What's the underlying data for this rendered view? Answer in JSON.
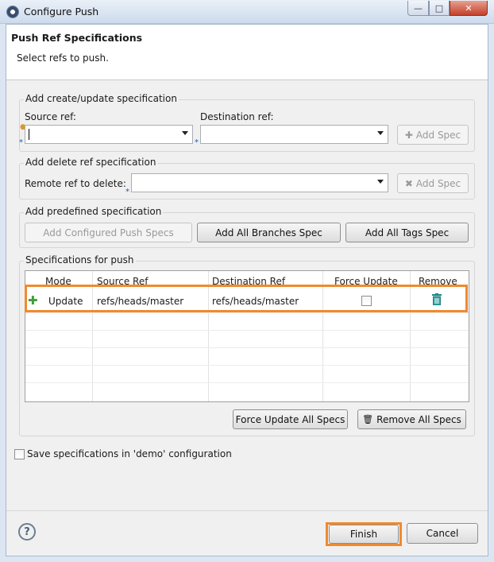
{
  "window": {
    "title": "Configure Push"
  },
  "header": {
    "title": "Push Ref Specifications",
    "subtitle": "Select refs to push."
  },
  "create_group": {
    "label": "Add create/update specification",
    "source_label": "Source ref:",
    "source_value": "",
    "dest_label": "Destination ref:",
    "dest_value": "",
    "add_button": "Add Spec"
  },
  "delete_group": {
    "label": "Add delete ref specification",
    "remote_label": "Remote ref to delete:",
    "remote_value": "",
    "add_button": "Add Spec"
  },
  "predefined_group": {
    "label": "Add predefined specification",
    "buttons": [
      "Add Configured Push Specs",
      "Add All Branches Spec",
      "Add All Tags Spec"
    ]
  },
  "specs_group": {
    "label": "Specifications for push",
    "columns": [
      "Mode",
      "Source Ref",
      "Destination Ref",
      "Force Update",
      "Remove"
    ],
    "rows": [
      {
        "mode": "Update",
        "source": "refs/heads/master",
        "destination": "refs/heads/master",
        "force": false
      }
    ],
    "force_all_button": "Force Update All Specs",
    "remove_all_button": "Remove All Specs"
  },
  "save_config": {
    "label": "Save specifications in 'demo' configuration",
    "checked": false
  },
  "footer": {
    "help": "?",
    "finish": "Finish",
    "cancel": "Cancel"
  },
  "colors": {
    "highlight": "#ef8a2e",
    "title_bar": "#cddbec"
  }
}
